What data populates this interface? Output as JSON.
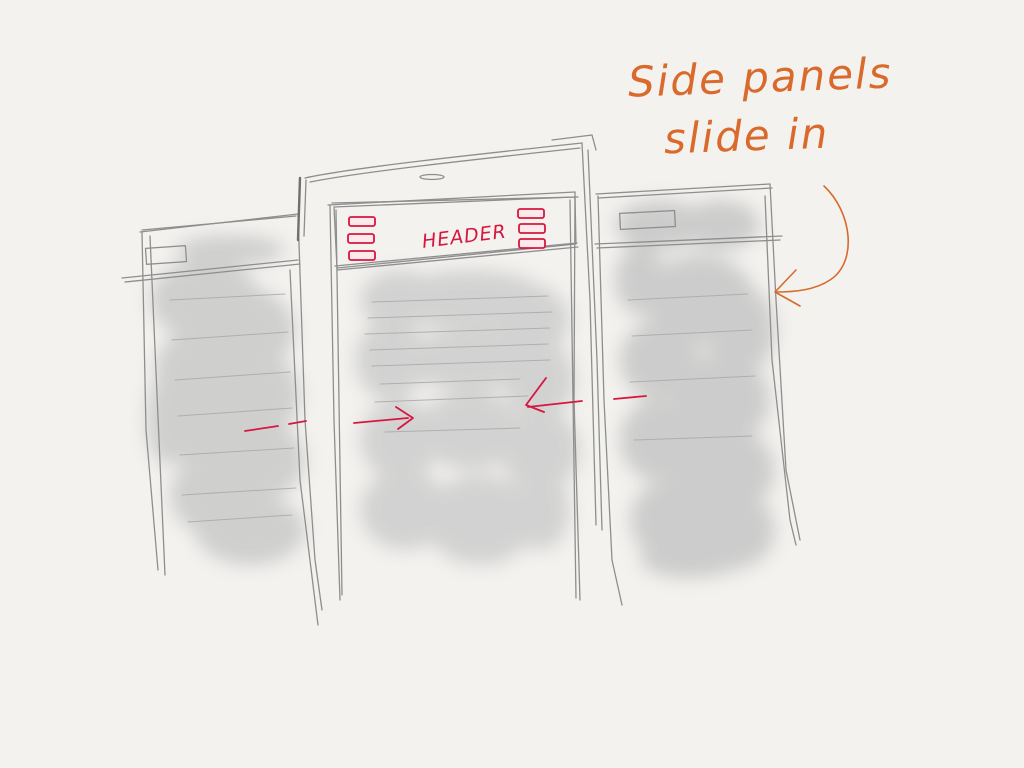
{
  "center_phone": {
    "header": {
      "title": "HEADER"
    }
  },
  "annotation": {
    "line1": "Side panels",
    "line2": "slide in"
  },
  "colors": {
    "paper": "#f3f2ef",
    "pencil": "#8e8e8e",
    "shading": "#c8c8c8",
    "header_red": "#d6173f",
    "annotation_orange": "#d96a2b"
  }
}
